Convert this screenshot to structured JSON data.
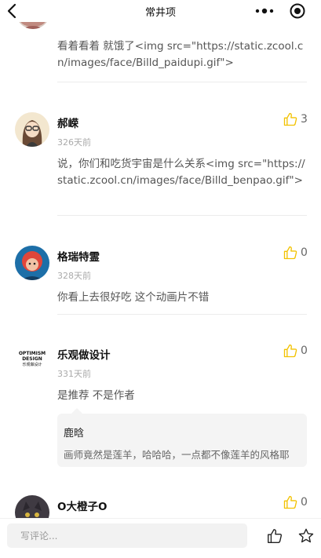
{
  "header": {
    "title": "常井项"
  },
  "colors": {
    "like_icon": "#f2c200",
    "divider": "#ececec",
    "reply_bg": "#f4f4f4"
  },
  "comments": [
    {
      "text": "看着看着 就饿了<img src=\"https://static.zcool.cn/images/face/Billd_paidupi.gif\">"
    },
    {
      "username": "郝嵘",
      "time": "326天前",
      "likes": "3",
      "text": "说，你们和吃货宇宙是什么关系<img src=\"https://static.zcool.cn/images/face/Billd_benpao.gif\">"
    },
    {
      "username": "格瑞特霊",
      "time": "328天前",
      "likes": "0",
      "text": "你看上去很好吃 这个动画片不错"
    },
    {
      "username": "乐观做设计",
      "avatar_text": [
        "OPTIMISM",
        "DESIGN",
        "乐观做设计"
      ],
      "time": "331天前",
      "likes": "0",
      "text": "是推荐 不是作者",
      "reply": {
        "name": "鹿晗",
        "text": "画师竟然是莲羊，哈哈哈，一点都不像莲羊的风格耶"
      }
    },
    {
      "username": "O大橙子O",
      "likes": "0"
    }
  ],
  "bottom_bar": {
    "input_placeholder": "写评论..."
  },
  "icons": {
    "back": "chevron-left-icon",
    "more": "more-dots-icon",
    "close": "target-circle-icon",
    "like": "thumbs-up-icon",
    "favorite": "star-icon"
  }
}
